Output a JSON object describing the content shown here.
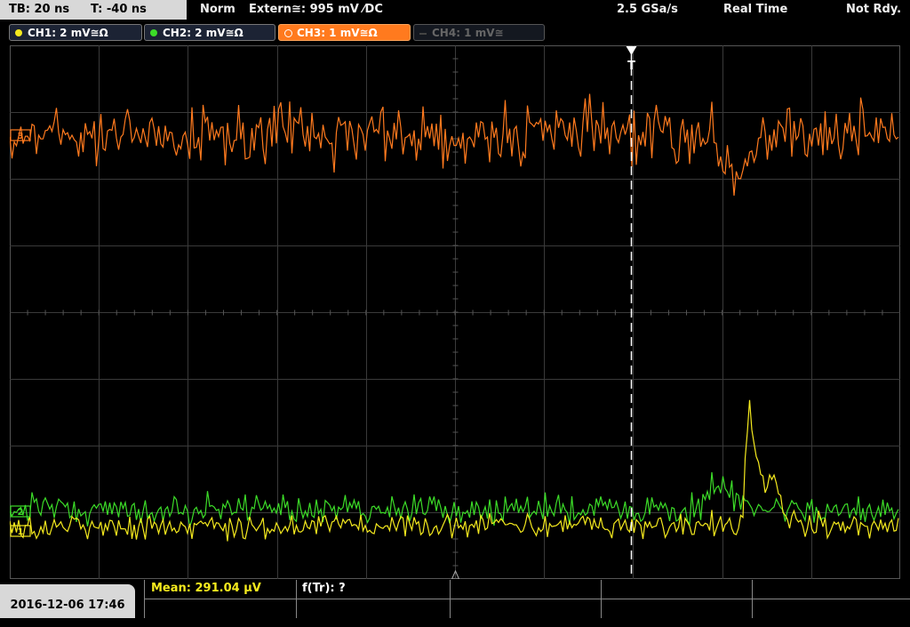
{
  "header": {
    "timebase": "TB: 20 ns",
    "trigger_time": "T: -40 ns",
    "mode": "Norm",
    "trigger_source": "Extern≅: 995 mV ⁄DC",
    "sample_rate": "2.5 GSa/s",
    "acquisition": "Real Time",
    "status": "Not Rdy."
  },
  "channels": [
    {
      "label": "CH1: 2 mV≅Ω",
      "color": "#f5ea1e",
      "state": "on"
    },
    {
      "label": "CH2: 2 mV≅Ω",
      "color": "#3cdc28",
      "state": "on"
    },
    {
      "label": "CH3: 1 mV≅Ω",
      "color": "#ff7a1e",
      "state": "selected"
    },
    {
      "label": "CH4: 1 mV≅",
      "color": "#666666",
      "state": "off"
    }
  ],
  "markers": {
    "ch3_marker": "3",
    "ch2_marker": "2",
    "ch1_marker": "1",
    "trigger_marker": "T"
  },
  "footer": {
    "datetime": "2016-12-06 17:46",
    "measurement_1": "Mean: 291.04 µV",
    "measurement_2": "f(Tr): ?"
  },
  "colors": {
    "ch1": "#f5ea1e",
    "ch2": "#3cdc28",
    "ch3": "#ff7a1e",
    "grid": "#3a3a3a",
    "trigger_line": "#ffffff"
  }
}
